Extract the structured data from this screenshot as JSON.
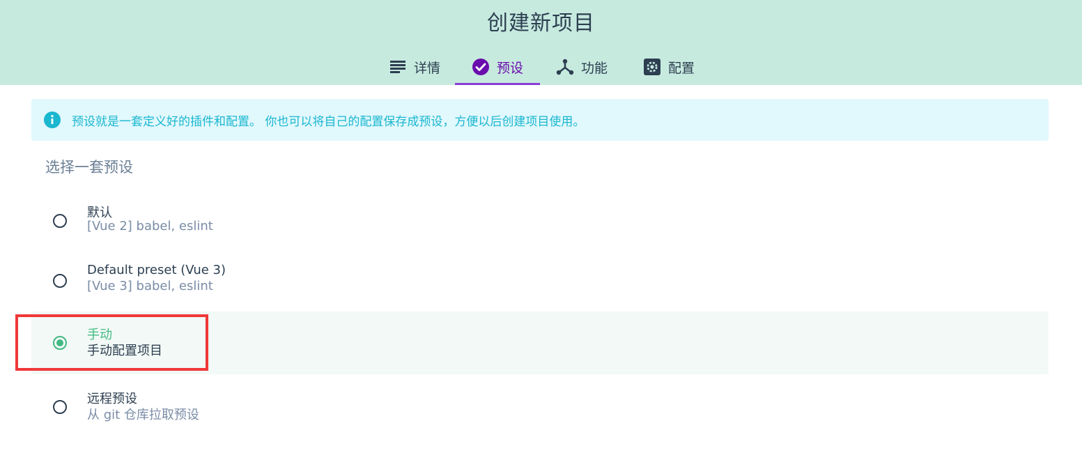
{
  "page": {
    "title": "创建新项目"
  },
  "tabs": [
    {
      "label": "详情",
      "icon": "list-icon",
      "active": false
    },
    {
      "label": "预设",
      "icon": "check-circle-icon",
      "active": true
    },
    {
      "label": "功能",
      "icon": "merge-icon",
      "active": false
    },
    {
      "label": "配置",
      "icon": "gear-icon",
      "active": false
    }
  ],
  "info": {
    "icon": "info-icon",
    "text": "预设就是一套定义好的插件和配置。 你也可以将自己的配置保存成预设，方便以后创建项目使用。"
  },
  "section": {
    "title": "选择一套预设"
  },
  "presets": [
    {
      "name": "默认",
      "description": "[Vue 2] babel, eslint",
      "selected": false
    },
    {
      "name": "Default preset (Vue 3)",
      "description": "[Vue 3] babel, eslint",
      "selected": false
    },
    {
      "name": "手动",
      "description": "手动配置项目",
      "selected": true
    },
    {
      "name": "远程预设",
      "description": "从 git 仓库拉取预设",
      "selected": false
    }
  ],
  "colors": {
    "header_bg": "#c7eadf",
    "accent": "#6a0dad",
    "selected": "#42b983",
    "info": "#1ab7cf",
    "annotation": "#f03838"
  }
}
